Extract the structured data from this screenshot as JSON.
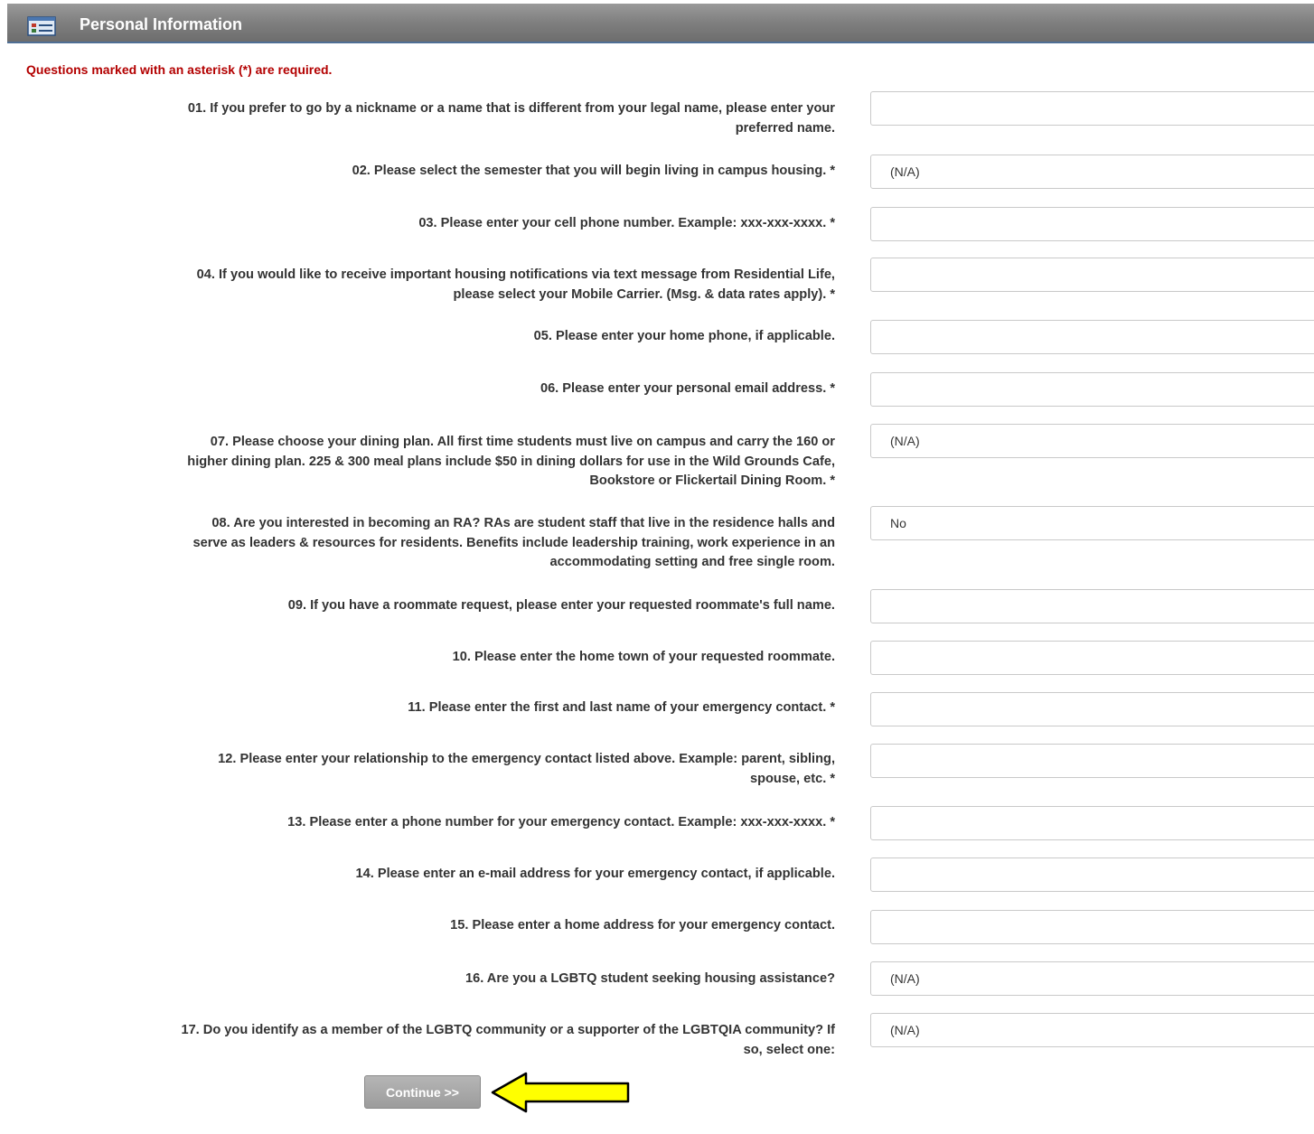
{
  "header": {
    "title": "Personal Information",
    "icon": "form-list-icon"
  },
  "required_note": "Questions marked with an asterisk (*) are required.",
  "questions": [
    {
      "lines": [
        "01. If you prefer to go by a nickname or a name that is different from your legal name, please enter your",
        "preferred name."
      ],
      "required": false,
      "type": "text",
      "value": ""
    },
    {
      "lines": [
        "02. Please select the semester that you will begin living in campus housing."
      ],
      "required": true,
      "type": "select",
      "value": "(N/A)"
    },
    {
      "lines": [
        "03. Please enter your cell phone number. Example: xxx-xxx-xxxx."
      ],
      "required": true,
      "type": "text",
      "value": ""
    },
    {
      "lines": [
        "04. If you would like to receive important housing notifications via text message from Residential Life,",
        "please select your Mobile Carrier. (Msg. & data rates apply)."
      ],
      "required": true,
      "type": "text",
      "value": ""
    },
    {
      "lines": [
        "05. Please enter your home phone, if applicable."
      ],
      "required": false,
      "type": "text",
      "value": ""
    },
    {
      "lines": [
        "06. Please enter your personal email address."
      ],
      "required": true,
      "type": "text",
      "value": ""
    },
    {
      "lines": [
        "07. Please choose your dining plan. All first time students must live on campus and carry the 160 or",
        "higher dining plan. 225 & 300 meal plans include $50 in dining dollars for use in the Wild Grounds Cafe,",
        "Bookstore or Flickertail Dining Room."
      ],
      "required": true,
      "type": "select",
      "value": "(N/A)"
    },
    {
      "lines": [
        "08. Are you interested in becoming an RA? RAs are student staff that live in the residence halls and",
        "serve as leaders & resources for residents. Benefits include leadership training, work experience in an",
        "accommodating setting and free single room."
      ],
      "required": false,
      "type": "select",
      "value": "No"
    },
    {
      "lines": [
        "09. If you have a roommate request, please enter your requested roommate's full name."
      ],
      "required": false,
      "type": "text",
      "value": ""
    },
    {
      "lines": [
        "10. Please enter the home town of your requested roommate."
      ],
      "required": false,
      "type": "text",
      "value": ""
    },
    {
      "lines": [
        "11. Please enter the first and last name of your emergency contact."
      ],
      "required": true,
      "type": "text",
      "value": ""
    },
    {
      "lines": [
        "12. Please enter your relationship to the emergency contact listed above. Example: parent, sibling,",
        "spouse, etc."
      ],
      "required": true,
      "type": "text",
      "value": ""
    },
    {
      "lines": [
        "13. Please enter a phone number for your emergency contact. Example: xxx-xxx-xxxx."
      ],
      "required": true,
      "type": "text",
      "value": ""
    },
    {
      "lines": [
        "14. Please enter an e-mail address for your emergency contact, if applicable."
      ],
      "required": false,
      "type": "text",
      "value": ""
    },
    {
      "lines": [
        "15. Please enter a home address for your emergency contact."
      ],
      "required": false,
      "type": "text",
      "value": ""
    },
    {
      "lines": [
        "16. Are you a LGBTQ student seeking housing assistance?"
      ],
      "required": false,
      "type": "select",
      "value": "(N/A)"
    },
    {
      "lines": [
        "17. Do you identify as a member of the LGBTQ community or a supporter of the LGBTQIA community? If",
        "so, select one:"
      ],
      "required": false,
      "type": "select",
      "value": "(N/A)"
    }
  ],
  "required_marker": "*",
  "continue_label": "Continue >>",
  "colors": {
    "required_note": "#b30000",
    "arrow_fill": "#ffff00",
    "header_border": "#4f6f95"
  }
}
